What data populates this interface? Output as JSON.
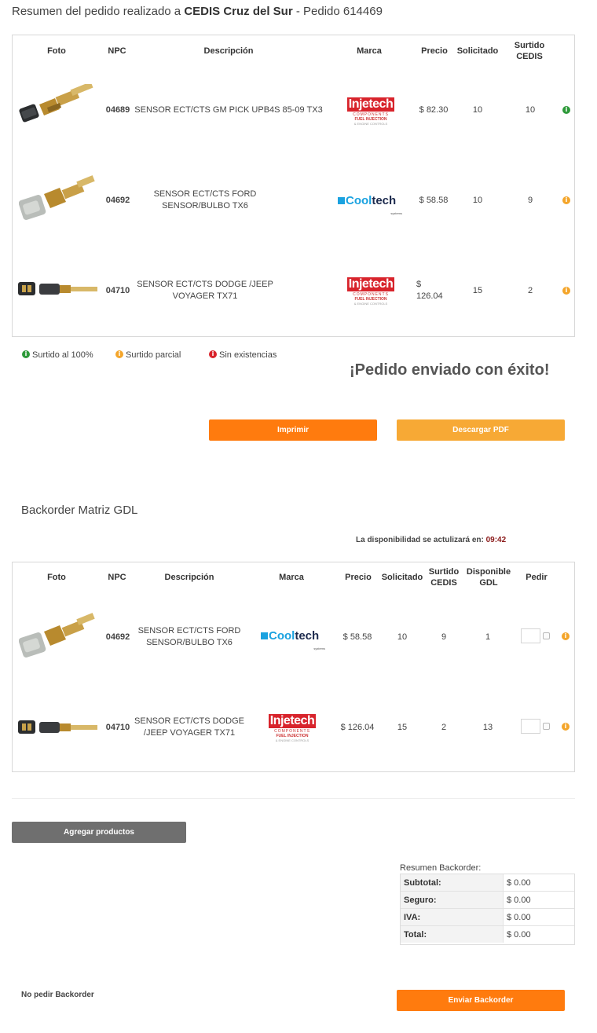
{
  "header": {
    "prefix": "Resumen del pedido realizado a ",
    "cedis": "CEDIS Cruz del Sur",
    "suffix": " - Pedido 614469"
  },
  "order_table": {
    "columns": [
      "Foto",
      "NPC",
      "Descripción",
      "Marca",
      "Precio",
      "Solicitado",
      "Surtido CEDIS"
    ],
    "rows": [
      {
        "npc": "04689",
        "descripcion": "SENSOR ECT/CTS GM PICK UPB4S 85-09 TX3",
        "marca": "injetech",
        "precio": "$ 82.30",
        "solicitado": "10",
        "surtido": "10",
        "status": "green",
        "photo": "sensor-black"
      },
      {
        "npc": "04692",
        "descripcion": "SENSOR ECT/CTS FORD SENSOR/BULBO TX6",
        "marca": "cooltech",
        "precio": "$ 58.58",
        "solicitado": "10",
        "surtido": "9",
        "status": "orange",
        "photo": "sensor-gray"
      },
      {
        "npc": "04710",
        "descripcion": "SENSOR ECT/CTS DODGE /JEEP VOYAGER TX71",
        "marca": "injetech",
        "precio": "$ 126.04",
        "solicitado": "15",
        "surtido": "2",
        "status": "orange",
        "photo": "sensor-long"
      }
    ]
  },
  "brands": {
    "injetech": {
      "name": "Injetech",
      "sub1": "COMPONENTS",
      "sub2": "FUEL INJECTION",
      "sub3": "& ENGINE CONTROLS"
    },
    "cooltech": {
      "name_a": "Cool",
      "name_b": "tech",
      "sub": "systems"
    }
  },
  "legend": {
    "full": "Surtido al 100%",
    "partial": "Surtido parcial",
    "none": "Sin existencias"
  },
  "success_message": "¡Pedido enviado con éxito!",
  "buttons": {
    "print": "Imprimir",
    "download_pdf": "Descargar PDF",
    "add_products": "Agregar productos",
    "send_backorder": "Enviar Backorder"
  },
  "backorder": {
    "title": "Backorder Matriz GDL",
    "availability_label": "La disponibilidad se actulizará en:",
    "availability_time": "09:42",
    "columns": [
      "Foto",
      "NPC",
      "Descripción",
      "Marca",
      "Precio",
      "Solicitado",
      "Surtido CEDIS",
      "Disponible GDL",
      "Pedir"
    ],
    "rows": [
      {
        "npc": "04692",
        "descripcion": "SENSOR ECT/CTS FORD SENSOR/BULBO TX6",
        "marca": "cooltech",
        "precio": "$ 58.58",
        "solicitado": "10",
        "surtido": "9",
        "disponible": "1",
        "status": "orange",
        "photo": "sensor-gray"
      },
      {
        "npc": "04710",
        "descripcion": "SENSOR ECT/CTS DODGE /JEEP VOYAGER TX71",
        "marca": "injetech",
        "precio": "$ 126.04",
        "solicitado": "15",
        "surtido": "2",
        "disponible": "13",
        "status": "orange",
        "photo": "sensor-long"
      }
    ]
  },
  "summary": {
    "title": "Resumen Backorder:",
    "rows": [
      {
        "label": "Subtotal:",
        "value": "$ 0.00"
      },
      {
        "label": "Seguro:",
        "value": "$ 0.00"
      },
      {
        "label": "IVA:",
        "value": "$ 0.00"
      },
      {
        "label": "Total:",
        "value": "$ 0.00"
      }
    ]
  },
  "no_backorder_link": "No pedir Backorder",
  "colors": {
    "status_green": "#2e9a3a",
    "status_orange": "#f4a52a",
    "status_red": "#d9232b",
    "button_orange": "#ff7b0e",
    "button_light_orange": "#f7a935",
    "button_gray": "#6f6f6f"
  }
}
